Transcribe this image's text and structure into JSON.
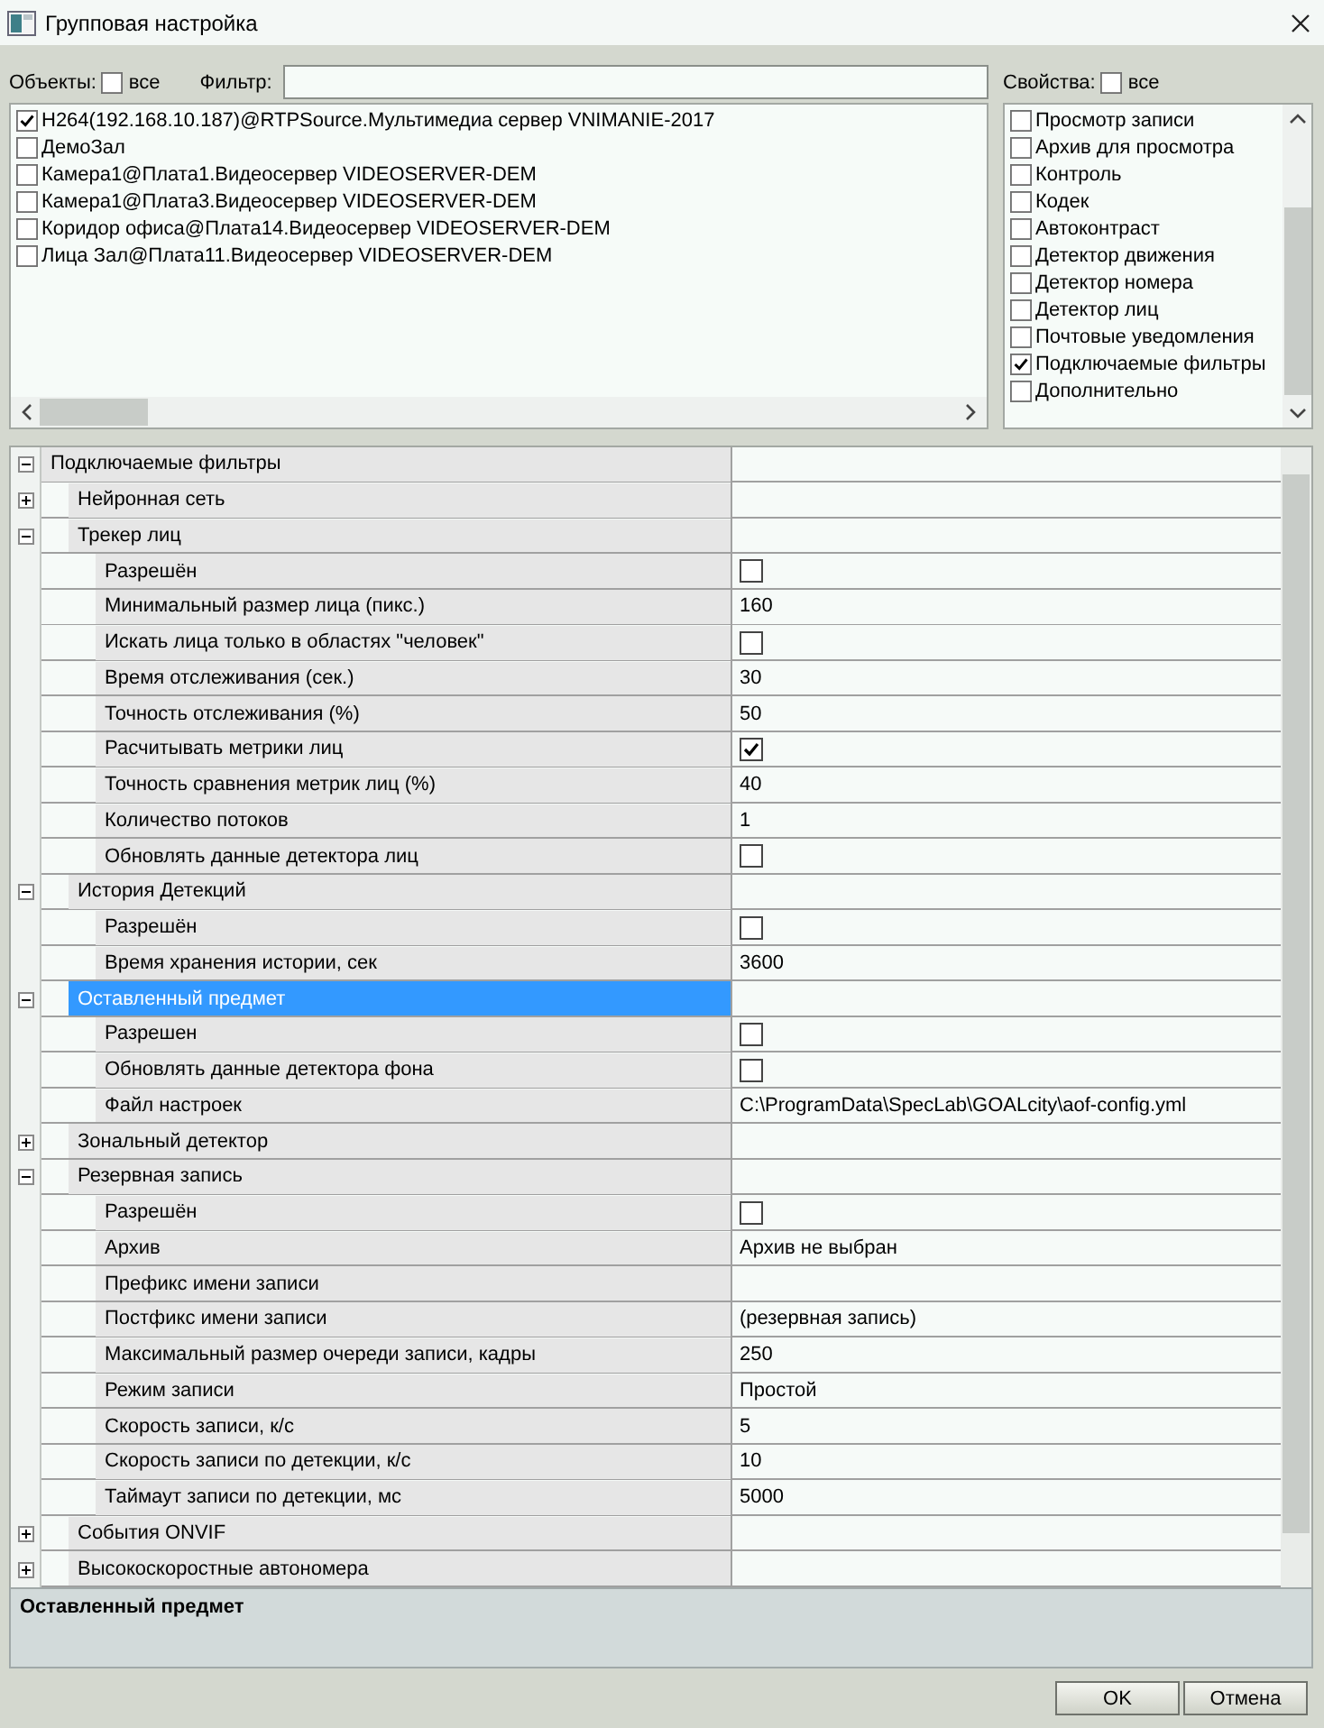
{
  "window": {
    "title": "Групповая настройка"
  },
  "objects": {
    "label": "Объекты:",
    "all_label": "все",
    "all_checked": false,
    "filter_label": "Фильтр:",
    "items": [
      {
        "label": "H264(192.168.10.187)@RTPSource.Мультимедиа сервер VNIMANIE-2017",
        "checked": true
      },
      {
        "label": "ДемоЗал",
        "checked": false
      },
      {
        "label": "Камера1@Плата1.Видеосервер VIDEOSERVER-DEM",
        "checked": false
      },
      {
        "label": "Камера1@Плата3.Видеосервер VIDEOSERVER-DEM",
        "checked": false
      },
      {
        "label": "Коридор офиса@Плата14.Видеосервер VIDEOSERVER-DEM",
        "checked": false
      },
      {
        "label": "Лица Зал@Плата11.Видеосервер VIDEOSERVER-DEM",
        "checked": false
      }
    ]
  },
  "properties": {
    "label": "Свойства:",
    "all_label": "все",
    "all_checked": false,
    "items": [
      {
        "label": "Просмотр записи",
        "checked": false
      },
      {
        "label": "Архив для просмотра",
        "checked": false
      },
      {
        "label": "Контроль",
        "checked": false
      },
      {
        "label": "Кодек",
        "checked": false
      },
      {
        "label": "Автоконтраст",
        "checked": false
      },
      {
        "label": "Детектор движения",
        "checked": false
      },
      {
        "label": "Детектор номера",
        "checked": false
      },
      {
        "label": "Детектор лиц",
        "checked": false
      },
      {
        "label": "Почтовые уведомления",
        "checked": false
      },
      {
        "label": "Подключаемые фильтры",
        "checked": true
      },
      {
        "label": "Дополнительно",
        "checked": false
      }
    ]
  },
  "property_grid": {
    "rows": [
      {
        "name": "Подключаемые фильтры",
        "kind": "category",
        "expanded": true,
        "selected": false,
        "children": [
          {
            "name": "Нейронная сеть",
            "kind": "category",
            "expanded": false,
            "selected": false
          },
          {
            "name": "Трекер лиц",
            "kind": "category",
            "expanded": true,
            "selected": false,
            "children": [
              {
                "name": "Разрешён",
                "kind": "checkbox",
                "checked": false,
                "selected": false
              },
              {
                "name": "Минимальный размер лица (пикс.)",
                "kind": "text",
                "value": "160",
                "selected": false
              },
              {
                "name": "Искать лица только в областях \"человек\"",
                "kind": "checkbox",
                "checked": false,
                "selected": false
              },
              {
                "name": "Время отслеживания (сек.)",
                "kind": "text",
                "value": "30",
                "selected": false
              },
              {
                "name": "Точность отслеживания (%)",
                "kind": "text",
                "value": "50",
                "selected": false
              },
              {
                "name": "Расчитывать метрики лиц",
                "kind": "checkbox",
                "checked": true,
                "selected": false
              },
              {
                "name": "Точность сравнения метрик лиц (%)",
                "kind": "text",
                "value": "40",
                "selected": false
              },
              {
                "name": "Количество потоков",
                "kind": "text",
                "value": "1",
                "selected": false
              },
              {
                "name": "Обновлять данные детектора лиц",
                "kind": "checkbox",
                "checked": false,
                "selected": false
              }
            ]
          },
          {
            "name": "История Детекций",
            "kind": "category",
            "expanded": true,
            "selected": false,
            "children": [
              {
                "name": "Разрешён",
                "kind": "checkbox",
                "checked": false,
                "selected": false
              },
              {
                "name": "Время хранения истории, сек",
                "kind": "text",
                "value": "3600",
                "selected": false
              }
            ]
          },
          {
            "name": "Оставленный предмет",
            "kind": "category",
            "expanded": true,
            "selected": true,
            "children": [
              {
                "name": "Разрешен",
                "kind": "checkbox",
                "checked": false,
                "selected": false
              },
              {
                "name": "Обновлять данные детектора фона",
                "kind": "checkbox",
                "checked": false,
                "selected": false
              },
              {
                "name": "Файл настроек",
                "kind": "text",
                "value": "C:\\ProgramData\\SpecLab\\GOALcity\\aof-config.yml",
                "selected": false
              }
            ]
          },
          {
            "name": "Зональный детектор",
            "kind": "category",
            "expanded": false,
            "selected": false
          },
          {
            "name": "Резервная запись",
            "kind": "category",
            "expanded": true,
            "selected": false,
            "children": [
              {
                "name": "Разрешён",
                "kind": "checkbox",
                "checked": false,
                "selected": false
              },
              {
                "name": "Архив",
                "kind": "text",
                "value": "Архив не выбран",
                "selected": false
              },
              {
                "name": "Префикс имени записи",
                "kind": "text",
                "selected": false
              },
              {
                "name": "Постфикс имени записи",
                "kind": "text",
                "value": "(резервная запись)",
                "selected": false
              },
              {
                "name": "Максимальный размер очереди записи, кадры",
                "kind": "text",
                "value": "250",
                "selected": false
              },
              {
                "name": "Режим записи",
                "kind": "text",
                "value": "Простой",
                "selected": false
              },
              {
                "name": "Скорость записи, к/с",
                "kind": "text",
                "value": "5",
                "selected": false
              },
              {
                "name": "Скорость записи по детекции, к/с",
                "kind": "text",
                "value": "10",
                "selected": false
              },
              {
                "name": "Таймаут записи по детекции, мс",
                "kind": "text",
                "value": "5000",
                "selected": false
              }
            ]
          },
          {
            "name": "События ONVIF",
            "kind": "category",
            "expanded": false,
            "selected": false
          },
          {
            "name": "Высокоскоростные автономера",
            "kind": "category",
            "expanded": false,
            "selected": false
          }
        ]
      }
    ]
  },
  "description": {
    "title": "Оставленный предмет"
  },
  "buttons": [
    "OK",
    "Отмена"
  ]
}
